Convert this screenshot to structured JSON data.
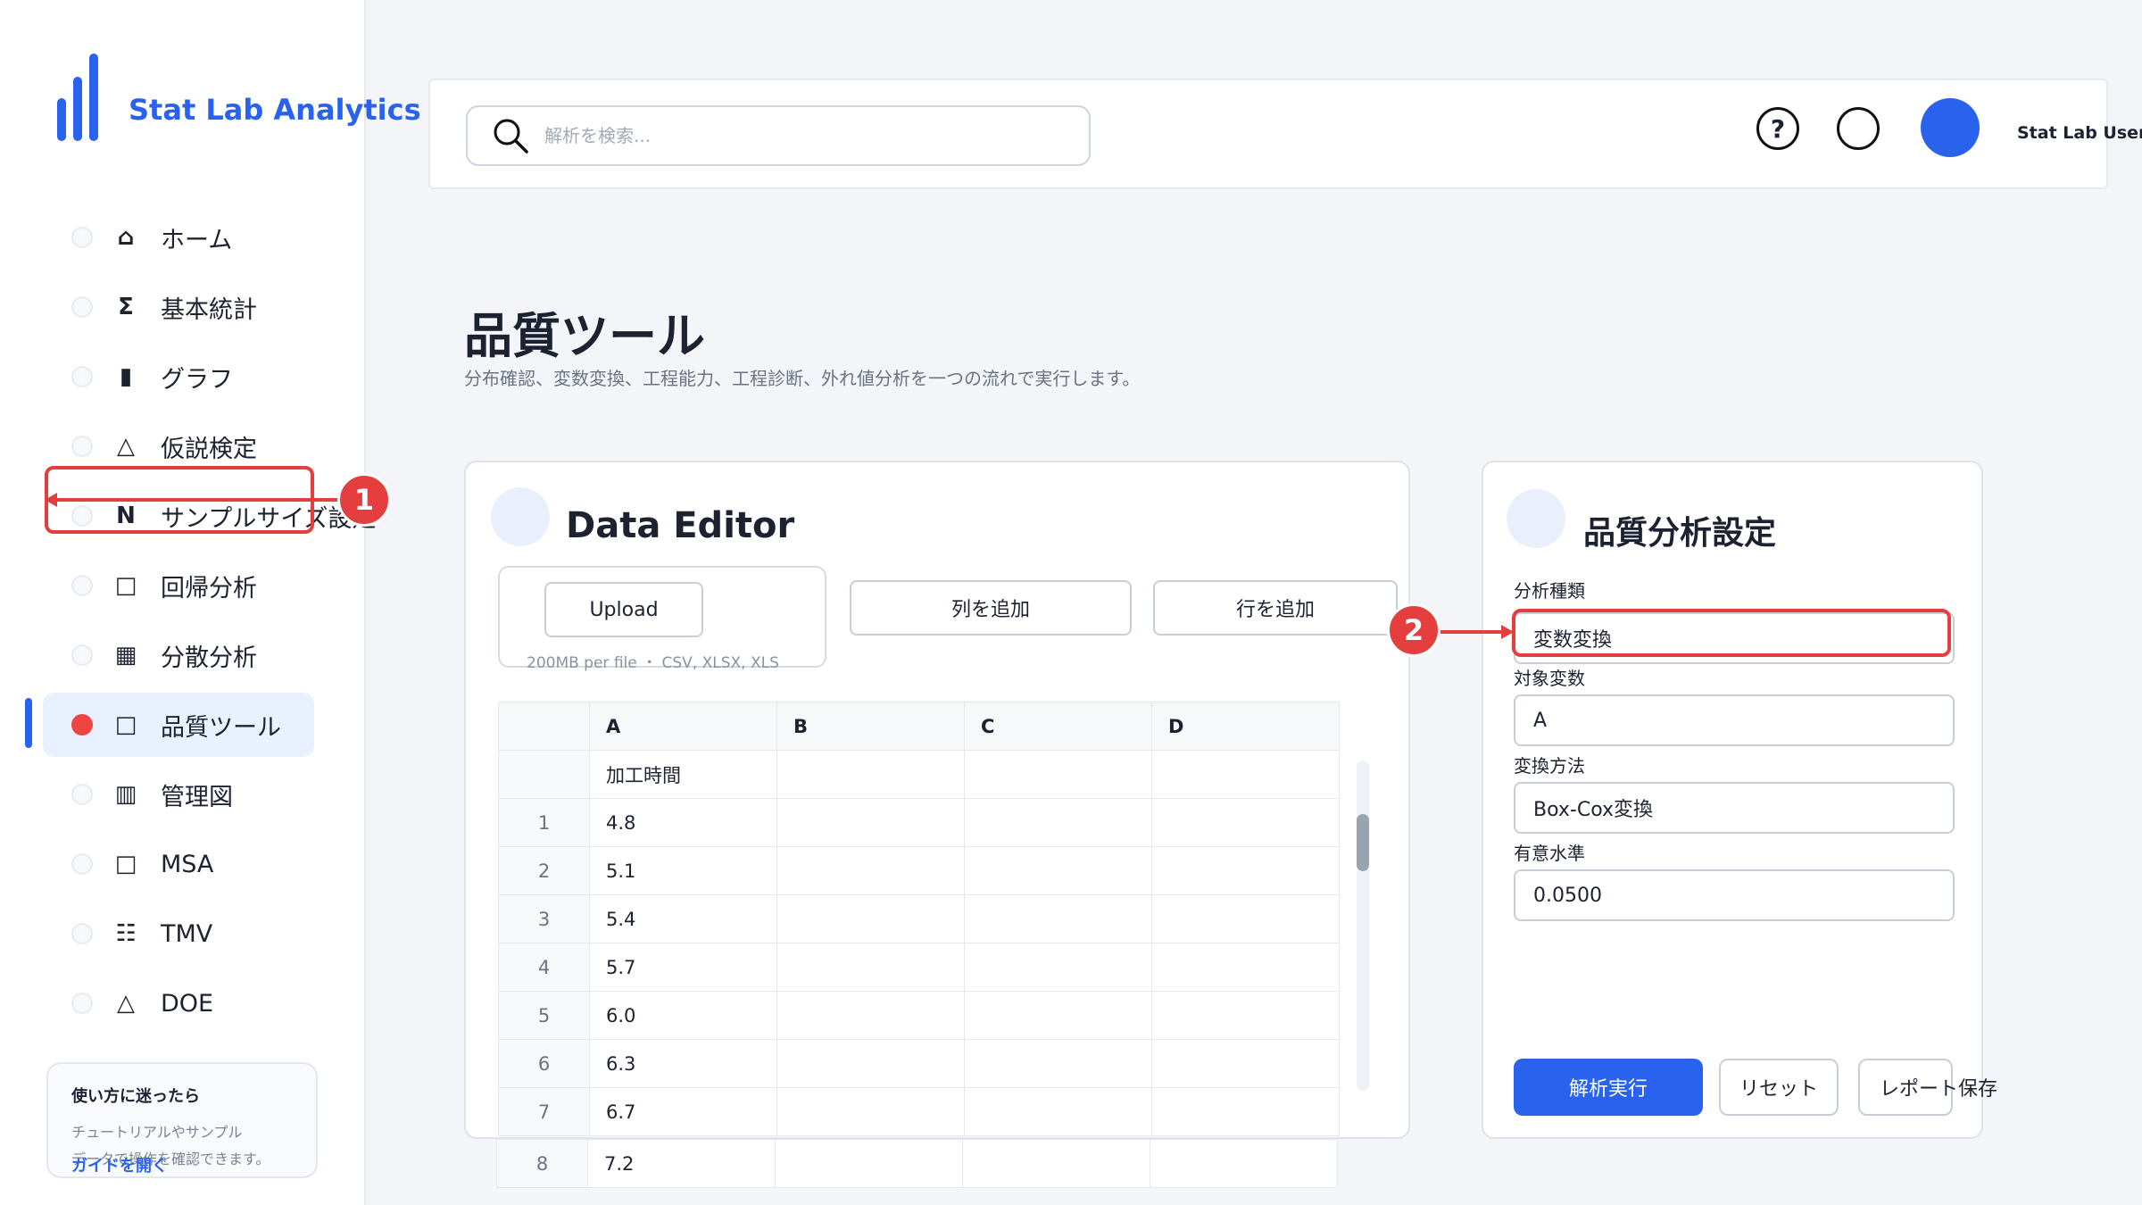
{
  "app": {
    "name": "Stat Lab Analytics"
  },
  "sidebar": {
    "items": [
      {
        "icon": "⌂",
        "label": "ホーム"
      },
      {
        "icon": "Σ",
        "label": "基本統計"
      },
      {
        "icon": "▮",
        "label": "グラフ"
      },
      {
        "icon": "△",
        "label": "仮説検定"
      },
      {
        "icon": "N",
        "label": "サンプルサイズ設定"
      },
      {
        "icon": "□",
        "label": "回帰分析"
      },
      {
        "icon": "▦",
        "label": "分散分析"
      },
      {
        "icon": "□",
        "label": "品質ツール"
      },
      {
        "icon": "▥",
        "label": "管理図"
      },
      {
        "icon": "□",
        "label": "MSA"
      },
      {
        "icon": "☷",
        "label": "TMV"
      },
      {
        "icon": "△",
        "label": "DOE"
      }
    ],
    "active_label": "品質ツール",
    "help": {
      "title": "使い方に迷ったら",
      "desc_line1": "チュートリアルやサンプル",
      "desc_line2": "データで操作を確認できます。",
      "link": "ガイドを開く"
    }
  },
  "header": {
    "search_placeholder": "解析を検索...",
    "help_icon": "?",
    "username": "Stat Lab User"
  },
  "page": {
    "title": "品質ツール",
    "subtitle": "分布確認、変数変換、工程能力、工程診断、外れ値分析を一つの流れで実行します。"
  },
  "editor": {
    "title": "Data Editor",
    "upload_label": "Upload",
    "upload_note": "200MB per file ・ CSV, XLSX, XLS",
    "add_column": "列を追加",
    "add_row": "行を追加",
    "columns": [
      "A",
      "B",
      "C",
      "D"
    ],
    "column_names": [
      "加工時間",
      "",
      "",
      ""
    ],
    "rows": [
      {
        "n": "1",
        "a": "4.8"
      },
      {
        "n": "2",
        "a": "5.1"
      },
      {
        "n": "3",
        "a": "5.4"
      },
      {
        "n": "4",
        "a": "5.7"
      },
      {
        "n": "5",
        "a": "6.0"
      },
      {
        "n": "6",
        "a": "6.3"
      },
      {
        "n": "7",
        "a": "6.7"
      },
      {
        "n": "8",
        "a": "7.2"
      }
    ]
  },
  "settings": {
    "title": "品質分析設定",
    "analysis_type_label": "分析種類",
    "analysis_type_value": "変数変換",
    "target_var_label": "対象変数",
    "target_var_value": "A",
    "method_label": "変換方法",
    "method_value": "Box-Cox変換",
    "alpha_label": "有意水準",
    "alpha_value": "0.0500",
    "run": "解析実行",
    "reset": "リセット",
    "save": "レポート保存"
  },
  "annotations": {
    "one": "1",
    "two": "2"
  },
  "colors": {
    "accent": "#2962ec",
    "annotation": "#e53e3e"
  }
}
